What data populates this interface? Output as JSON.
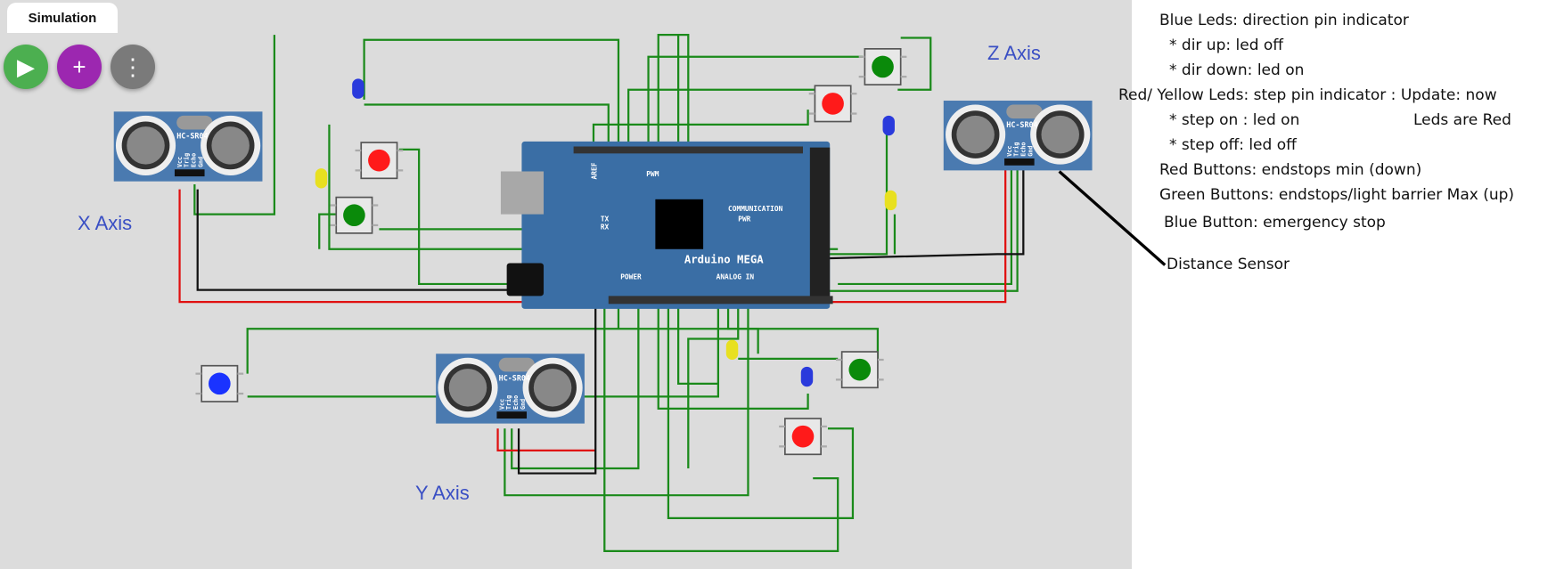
{
  "toolbar": {
    "tab_label": "Simulation",
    "buttons": [
      {
        "name": "play",
        "icon": "play-icon",
        "color": "#4caf50"
      },
      {
        "name": "add",
        "icon": "plus-icon",
        "color": "#9c27b0"
      },
      {
        "name": "more",
        "icon": "more-vertical-icon",
        "color": "#757575"
      }
    ]
  },
  "axes": {
    "x": "X Axis",
    "y": "Y Axis",
    "z": "Z Axis"
  },
  "sensor": {
    "model": "HC-SR04",
    "pins": [
      "Vcc",
      "Trig",
      "Echo",
      "Gnd"
    ]
  },
  "arduino": {
    "name": "Arduino MEGA",
    "pwm": "PWM",
    "communication": "COMMUNICATION",
    "power": "POWER",
    "analog": "ANALOG IN",
    "pwr_led": "PWR",
    "tx": "TX",
    "rx": "RX",
    "aref": "AREF"
  },
  "notes": {
    "line1": "Blue Leds: direction pin indicator",
    "line2": "* dir up: led off",
    "line3": "* dir down: led on",
    "line4": "Red/ Yellow Leds: step pin indicator : Update: now",
    "line5": "* step on : led on",
    "line5b": "Leds are Red",
    "line6": "* step off: led off",
    "line7": "Red Buttons: endstops min (down)",
    "line8": "Green Buttons: endstops/light barrier Max (up)",
    "line9": "Blue Button: emergency stop",
    "line10": "Distance Sensor"
  },
  "colors": {
    "wire": "#1a8a1a",
    "board": "#3a6ea5",
    "red_button": "#ff1a1a",
    "green_button": "#0a8a0a",
    "blue_button": "#1a33ff",
    "blue_led": "#2a3adc",
    "yellow_led": "#e8e020"
  }
}
